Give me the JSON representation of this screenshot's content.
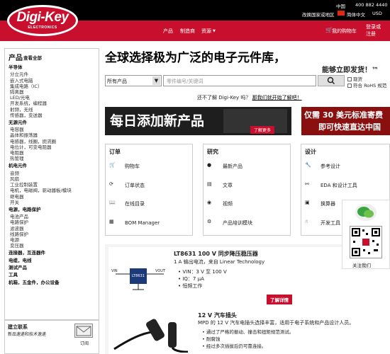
{
  "header": {
    "logo": {
      "main": "Digi-Key",
      "sub": "ELECTRONICS"
    },
    "region": "中国",
    "phone": "400 882 4440",
    "change_region": "改换国家或地区",
    "language": "简体中文",
    "currency": "USD",
    "nav": [
      "产品",
      "制造商",
      "资源"
    ],
    "cart": "我的购物车",
    "login": "登录或",
    "register": "注册"
  },
  "sidebar": {
    "title": "产品",
    "view_all": "查看全部",
    "sections": [
      {
        "label": "半导体",
        "items": [
          "分立元件",
          "嵌入式电脑",
          "集成电路（IC）",
          "隔离器",
          "LED/光电",
          "开发系统，编程器",
          "射频，无线",
          "传感器，变送器"
        ]
      },
      {
        "label": "无源元件",
        "items": [
          "电容器",
          "晶体和振荡器",
          "电感器，线圈，扼流圈",
          "电位计，可变电阻器",
          "电阻器",
          "热管理"
        ]
      },
      {
        "label": "机电元件",
        "items": [
          "音频",
          "风扇",
          "工业控制装置",
          "电机，电磁阀，驱动器板/模块",
          "继电器",
          "开关"
        ]
      },
      {
        "label": "电源，电路保护",
        "items": [
          "电池产品",
          "电路保护",
          "滤波器",
          "线路保护",
          "电源",
          "变压器"
        ]
      },
      {
        "label": "连接器，互连器件",
        "items": []
      },
      {
        "label": "电缆，电线",
        "items": []
      },
      {
        "label": "测试产品",
        "items": []
      },
      {
        "label": "工具",
        "items": []
      },
      {
        "label": "机箱，五金件，办公设备",
        "items": []
      }
    ],
    "connect_title": "建立联系",
    "connect_text": "新品速递和技术速递",
    "subscribe": "订阅"
  },
  "main": {
    "headline": "全球选择极为广泛的电子元件库，",
    "tagline": "能够立即发货！™",
    "search_select": "所有产品",
    "search_placeholder": "零件编号/关键词",
    "check_stock": "现货",
    "check_rohs": "符合 RoHS 规范",
    "prompt": "还不了解 Digi-Key 吗？",
    "prompt_link": "那我们就开始了解吧！",
    "banner1_text": "每日添加新产品",
    "banner1_more": "了解更多",
    "banner2_line1": "仅需 30 美元标准寄费",
    "banner2_line2": "即可快速直达中国",
    "boxes": [
      {
        "title": "订单",
        "items": [
          "购物车",
          "订单状态",
          "在线目录",
          "BOM Manager"
        ]
      },
      {
        "title": "研究",
        "items": [
          "最新产品",
          "文章",
          "视频",
          "产品培训模块"
        ]
      },
      {
        "title": "设计",
        "items": [
          "参考设计",
          "EDA 和设计工具",
          "换算器",
          "开发工具"
        ]
      }
    ],
    "product1": {
      "title": "LT8631 100 V 同步降压稳压器",
      "subtitle": "1 A 输出电流，来自 Linear Technology",
      "bullets": [
        "VIN：3 V 至 100 V",
        "IQ：7 μA",
        "恒频工作"
      ],
      "button": "了解详情",
      "chip_label": "LT8631",
      "vin": "VIN",
      "vout": "VOUT"
    },
    "product2": {
      "title": "12 V 汽车插头",
      "desc": "MPD 的 12 V 汽车电插头选择丰富，适用于电子系统和产品设计人员。",
      "bullets": [
        "通过了严格的振动、撞击和扭矩规范测试。",
        "耐腐蚀",
        "经过多次插拔后仍可靠连接。"
      ]
    },
    "wechat": "关注我们"
  },
  "colors": {
    "brand_red": "#c8102e",
    "black": "#000000",
    "grey_border": "#cccccc"
  }
}
